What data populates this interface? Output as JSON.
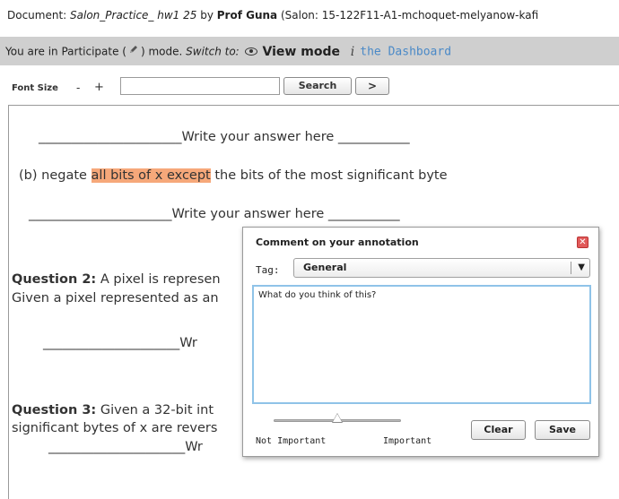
{
  "document_bar": {
    "prefix": "Document: ",
    "doc_name": "Salon_Practice_ hw1 25",
    "by": " by ",
    "author": "Prof Guna",
    "salon": " (Salon: 15-122F11-A1-mchoquet-melyanow-kafi"
  },
  "mode_bar": {
    "prefix": "You are in Participate (",
    "suffix": ") mode. ",
    "switch_to": "Switch to:",
    "view_mode": "View mode",
    "info_glyph": "i",
    "dashboard": "the Dashboard"
  },
  "toolbar": {
    "font_size_label": "Font Size",
    "minus": "-",
    "plus": "+",
    "search_value": "",
    "search_button": "Search",
    "go_button": ">"
  },
  "document": {
    "blank1_pre": "______________________",
    "blank1_text": "Write your answer here",
    "blank1_post": "___________",
    "b_pre": "(b) negate ",
    "b_highlight": "all bits of x except",
    "b_post": " the bits of the most significant byte",
    "blank2_pre": "______________________",
    "blank2_text": "Write your answer here",
    "blank2_post": "___________",
    "q2_label": "Question 2:",
    "q2_text": " A pixel is represen",
    "q2_line2": "Given a pixel represented as an",
    "blank3_pre": "_____________________",
    "blank3_text": "Wr",
    "q3_label": "Question 3:",
    "q3_text": " Given a 32-bit int",
    "q3_line2": "significant bytes of x are revers",
    "blank4_pre": "_____________________",
    "blank4_text": "Wr"
  },
  "comment_popup": {
    "title": "Comment on your annotation",
    "close_glyph": "✕",
    "tag_label": "Tag:",
    "tag_value": "General",
    "tag_arrow": "▼",
    "comment_value": "What do you think of this?",
    "importance": 0.5,
    "low_label": "Not Important",
    "high_label": "Important",
    "clear_button": "Clear",
    "save_button": "Save"
  }
}
